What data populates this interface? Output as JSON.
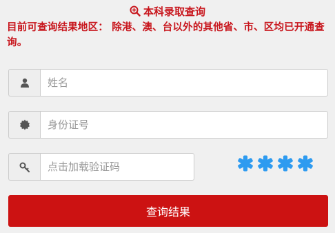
{
  "header": {
    "title": "本科录取查询",
    "icon": "search-zoom-icon"
  },
  "notice": "目前可查询结果地区： 除港、澳、台以外的其他省、市、区均已开通查询。",
  "form": {
    "name": {
      "placeholder": "姓名",
      "value": "",
      "icon": "user-icon"
    },
    "id_number": {
      "placeholder": "身份证号",
      "value": "",
      "icon": "certificate-icon"
    },
    "captcha": {
      "placeholder": "点击加载验证码",
      "value": "",
      "icon": "key-icon",
      "image_text": "****"
    },
    "submit_label": "查询结果"
  },
  "colors": {
    "accent": "#c8161d",
    "button": "#cc1212",
    "captcha_blue": "#2e9bf0",
    "background": "#f0f0f0"
  }
}
